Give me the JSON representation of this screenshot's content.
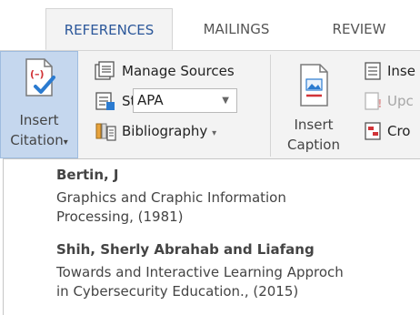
{
  "tabs": [
    {
      "label": "REFERENCES",
      "active": true
    },
    {
      "label": "MAILINGS",
      "active": false
    },
    {
      "label": "REVIEW",
      "active": false
    }
  ],
  "ribbon": {
    "insert_citation": {
      "line1": "Insert",
      "line2": "Citation",
      "arrow": "▾"
    },
    "manage_sources": "Manage Sources",
    "style": {
      "label": "Style:",
      "value": "APA"
    },
    "bibliography": {
      "label": "Bibliography",
      "arrow": "▾"
    },
    "insert_caption": {
      "line1": "Insert",
      "line2": "Caption"
    },
    "insert_cut": "Inse",
    "update_cut": "Upc",
    "cross_cut": "Cro"
  },
  "citations": [
    {
      "author": "Bertin, J",
      "desc_line1": "Graphics and Craphic Information",
      "desc_line2": "Processing, (1981)"
    },
    {
      "author": "Shih, Sherly Abrahab and Liafang",
      "desc_line1": "Towards and  Interactive Learning Approch",
      "desc_line2": "in Cybersecurity Education., (2015)"
    }
  ],
  "colors": {
    "accent": "#2b579a",
    "selected_bg": "#c5d7ee",
    "ribbon_bg": "#f3f3f3"
  }
}
